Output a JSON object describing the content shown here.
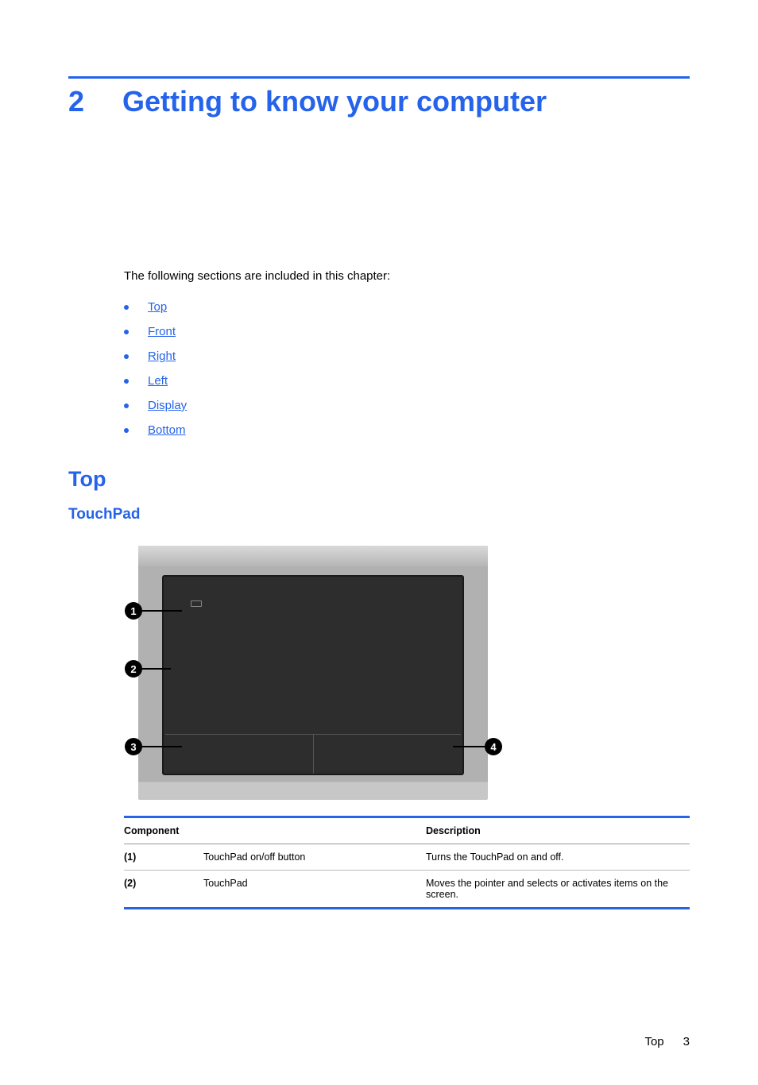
{
  "chapter": {
    "number": "2",
    "title": "Getting to know your computer"
  },
  "intro": "The following sections are included in this chapter:",
  "sections": [
    "Top",
    "Front",
    "Right",
    "Left",
    "Display",
    "Bottom"
  ],
  "heading1": "Top",
  "heading2": "TouchPad",
  "callouts": [
    "1",
    "2",
    "3",
    "4"
  ],
  "table": {
    "headers": [
      "Component",
      "Description"
    ],
    "rows": [
      {
        "ref": "(1)",
        "component": "TouchPad on/off button",
        "description": "Turns the TouchPad on and off."
      },
      {
        "ref": "(2)",
        "component": "TouchPad",
        "description": "Moves the pointer and selects or activates items on the screen."
      }
    ]
  },
  "footer": {
    "section": "Top",
    "page": "3"
  }
}
